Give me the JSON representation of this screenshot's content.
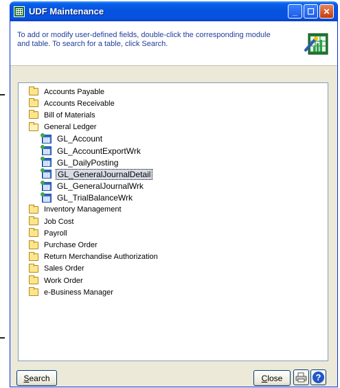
{
  "window": {
    "title": "UDF Maintenance",
    "minimize": "_",
    "maximize": "☐",
    "close": "✕"
  },
  "header": {
    "instructions": "To add or modify user-defined fields, double-click the corresponding module and table. To search for a table, click Search."
  },
  "tree": {
    "modules": [
      {
        "label": "Accounts Payable",
        "expanded": false
      },
      {
        "label": "Accounts Receivable",
        "expanded": false
      },
      {
        "label": "Bill of Materials",
        "expanded": false
      },
      {
        "label": "General Ledger",
        "expanded": true
      },
      {
        "label": "Inventory Management",
        "expanded": false
      },
      {
        "label": "Job Cost",
        "expanded": false
      },
      {
        "label": "Payroll",
        "expanded": false
      },
      {
        "label": "Purchase Order",
        "expanded": false
      },
      {
        "label": "Return Merchandise Authorization",
        "expanded": false
      },
      {
        "label": "Sales Order",
        "expanded": false
      },
      {
        "label": "Work Order",
        "expanded": false
      },
      {
        "label": "e-Business Manager",
        "expanded": false
      }
    ],
    "gl_tables": [
      {
        "label": "GL_Account"
      },
      {
        "label": "GL_AccountExportWrk"
      },
      {
        "label": "GL_DailyPosting"
      },
      {
        "label": "GL_GeneralJournalDetail",
        "selected": true
      },
      {
        "label": "GL_GeneralJournalWrk"
      },
      {
        "label": "GL_TrialBalanceWrk"
      }
    ]
  },
  "footer": {
    "search_first": "S",
    "search_rest": "earch",
    "close_first": "C",
    "close_rest": "lose",
    "help": "?"
  },
  "colors": {
    "title_bar": "#0453dd",
    "instruction_text": "#1f3d9a",
    "selection": "#d8dce6"
  }
}
